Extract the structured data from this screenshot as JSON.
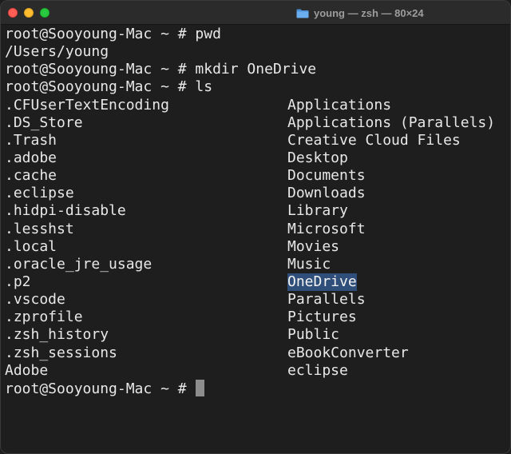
{
  "window": {
    "title": "young — zsh — 80×24",
    "title_icon": "folder-icon",
    "colors": {
      "background": "#1e1e1e",
      "text": "#e8e8e8",
      "selection": "#2f4f7a",
      "cursor": "#8d8d8d"
    }
  },
  "terminal": {
    "history": [
      "root@Sooyoung-Mac ~ # pwd",
      "/Users/young",
      "root@Sooyoung-Mac ~ # mkdir OneDrive",
      "root@Sooyoung-Mac ~ # ls"
    ],
    "ls_left": [
      ".CFUserTextEncoding",
      ".DS_Store",
      ".Trash",
      ".adobe",
      ".cache",
      ".eclipse",
      ".hidpi-disable",
      ".lesshst",
      ".local",
      ".oracle_jre_usage",
      ".p2",
      ".vscode",
      ".zprofile",
      ".zsh_history",
      ".zsh_sessions",
      "Adobe"
    ],
    "ls_right": [
      "Applications",
      "Applications (Parallels)",
      "Creative Cloud Files",
      "Desktop",
      "Documents",
      "Downloads",
      "Library",
      "Microsoft",
      "Movies",
      "Music",
      "OneDrive",
      "Parallels",
      "Pictures",
      "Public",
      "eBookConverter",
      "eclipse"
    ],
    "selected_entry": "OneDrive",
    "prompt": "root@Sooyoung-Mac ~ # "
  }
}
